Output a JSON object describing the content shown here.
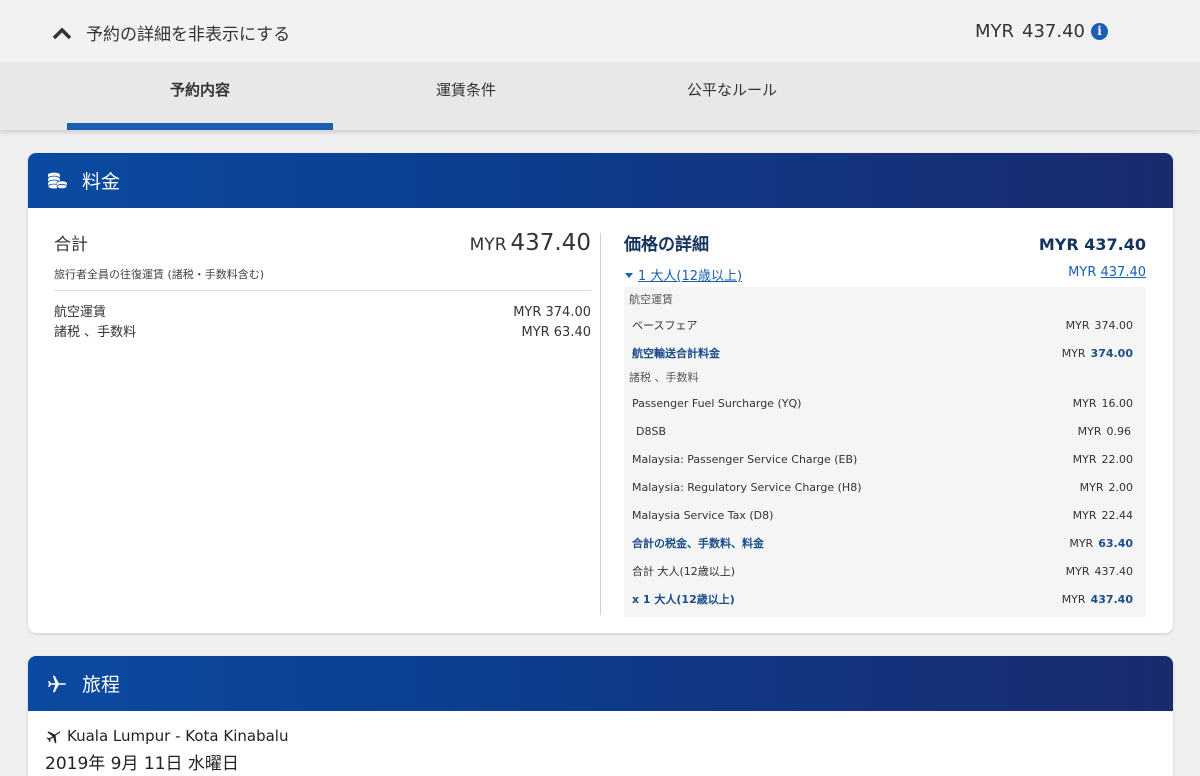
{
  "summary": {
    "toggle_label": "予約の詳細を非表示にする",
    "currency": "MYR",
    "amount": "437.40"
  },
  "tabs": [
    {
      "label": "予約内容",
      "active": true
    },
    {
      "label": "運賃条件",
      "active": false
    },
    {
      "label": "公平なルール",
      "active": false
    }
  ],
  "fare_card": {
    "title": "料金",
    "left": {
      "total_label": "合計",
      "total_currency": "MYR",
      "total_amount": "437.40",
      "subtitle": "旅行者全員の往復運賃 (諸税・手数料含む)",
      "lines": [
        {
          "label": "航空運賃",
          "value": "MYR 374.00"
        },
        {
          "label": "諸税 、手数料",
          "value": "MYR 63.40"
        }
      ]
    },
    "right": {
      "title": "価格の詳細",
      "total": "MYR 437.40",
      "pax_label": "1 大人(12歳以上)",
      "pax_currency": "MYR",
      "pax_amount": "437.40",
      "airfare_section": "航空運賃",
      "base_fare_label": "ベースフェア",
      "base_fare_cur": "MYR",
      "base_fare_amt": "374.00",
      "airfare_total_label": "航空輸送合計料金",
      "airfare_total_cur": "MYR",
      "airfare_total_amt": "374.00",
      "tax_section": "諸税 、手数料",
      "taxes": [
        {
          "label": "Passenger Fuel Surcharge (YQ)",
          "cur": "MYR",
          "amt": "16.00"
        },
        {
          "label": "D8SB",
          "cur": "MYR",
          "amt": "0.96"
        },
        {
          "label": "Malaysia: Passenger Service Charge (EB)",
          "cur": "MYR",
          "amt": "22.00"
        },
        {
          "label": "Malaysia: Regulatory Service Charge (H8)",
          "cur": "MYR",
          "amt": "2.00"
        },
        {
          "label": "Malaysia Service Tax (D8)",
          "cur": "MYR",
          "amt": "22.44"
        }
      ],
      "tax_total_label": "合計の税金、手数料、料金",
      "tax_total_cur": "MYR",
      "tax_total_amt": "63.40",
      "adult_total_label": "合計 大人(12歳以上)",
      "adult_total_cur": "MYR",
      "adult_total_amt": "437.40",
      "x1_label": "x 1 大人(12歳以上)",
      "x1_cur": "MYR",
      "x1_amt": "437.40"
    }
  },
  "itinerary_card": {
    "title": "旅程",
    "route": "Kuala Lumpur - Kota Kinabalu",
    "date": "2019年 9月 11日 水曜日"
  },
  "colors": {
    "accent": "#1a5fb4",
    "header_start": "#0b4aa2",
    "header_end": "#1a2a6e",
    "strong_text": "#1a4d8c"
  }
}
